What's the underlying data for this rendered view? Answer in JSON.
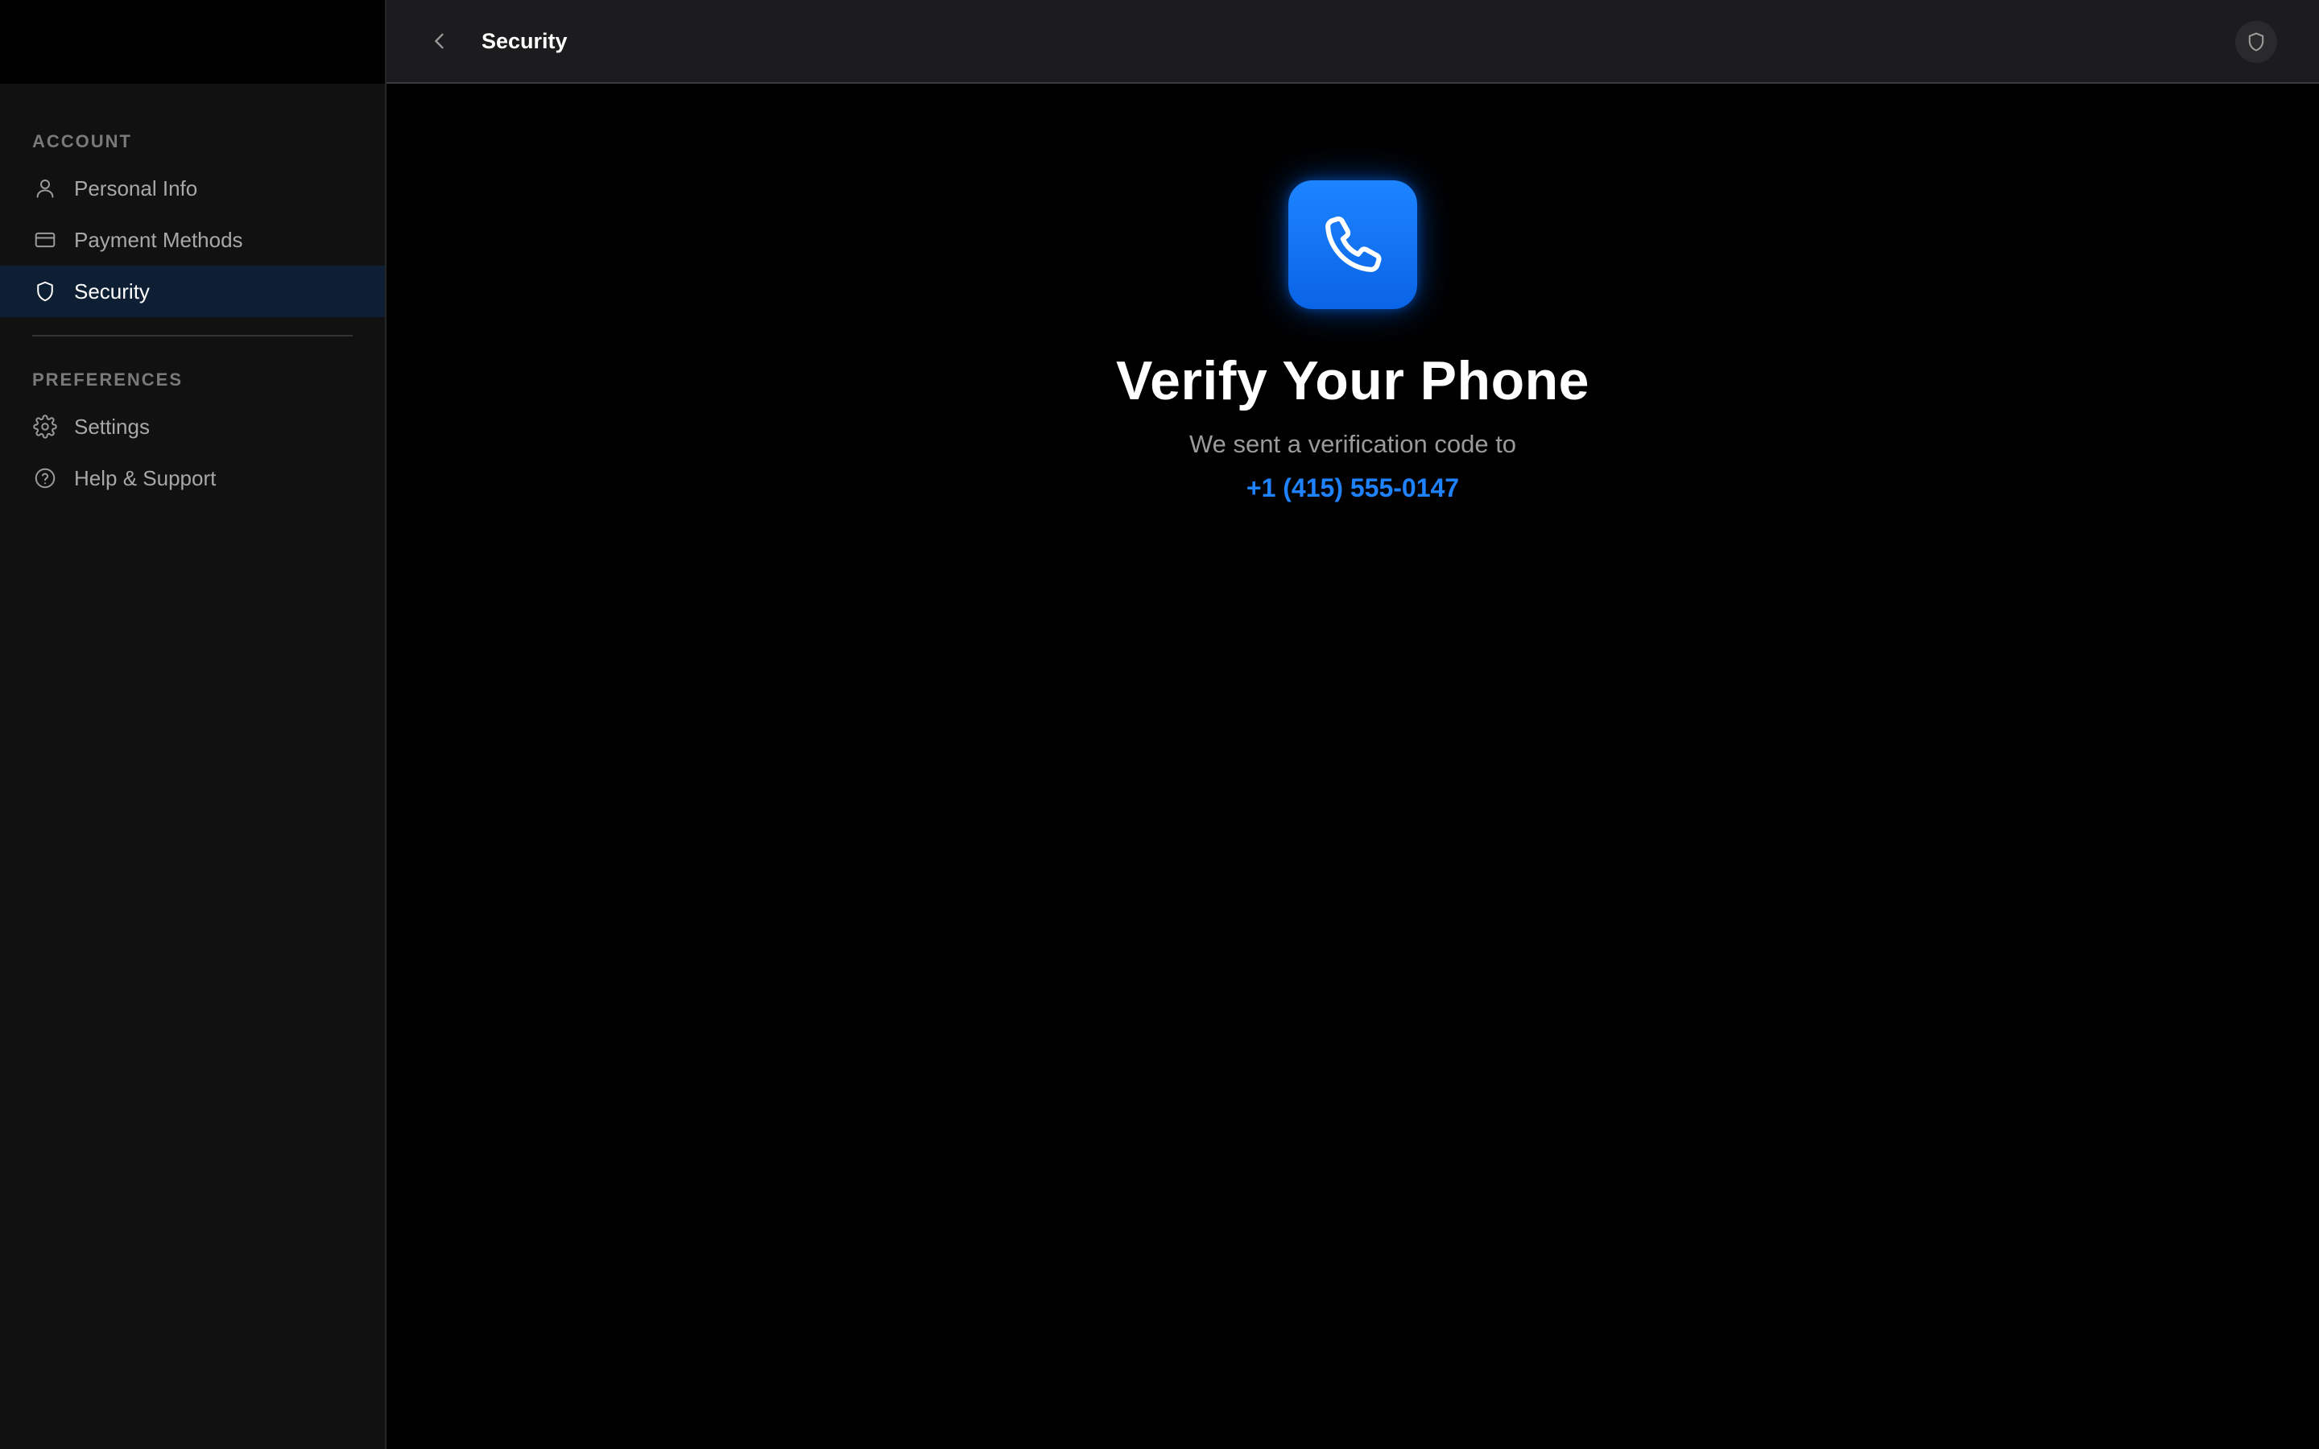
{
  "colors": {
    "accent": "#0a84ff",
    "active_bg": "#0e1f33",
    "sidebar_bg": "#111111",
    "header_bg": "#1c1c1e"
  },
  "sidebar": {
    "sections": [
      {
        "label": "ACCOUNT",
        "items": [
          {
            "label": "Personal Info",
            "icon": "person-icon"
          },
          {
            "label": "Payment Methods",
            "icon": "credit-card-icon"
          },
          {
            "label": "Security",
            "icon": "shield-icon",
            "active": true
          }
        ]
      },
      {
        "label": "PREFERENCES",
        "items": [
          {
            "label": "Settings",
            "icon": "gear-icon"
          },
          {
            "label": "Help & Support",
            "icon": "help-circle-icon"
          }
        ]
      }
    ]
  },
  "header": {
    "title": "Security",
    "back_icon": "chevron-left-icon",
    "right_icon": "shield-icon"
  },
  "main": {
    "icon": "phone-icon",
    "title": "Verify Your Phone",
    "subtitle": "We sent a verification code to",
    "phone_number": "+1 (415) 555-0147"
  }
}
